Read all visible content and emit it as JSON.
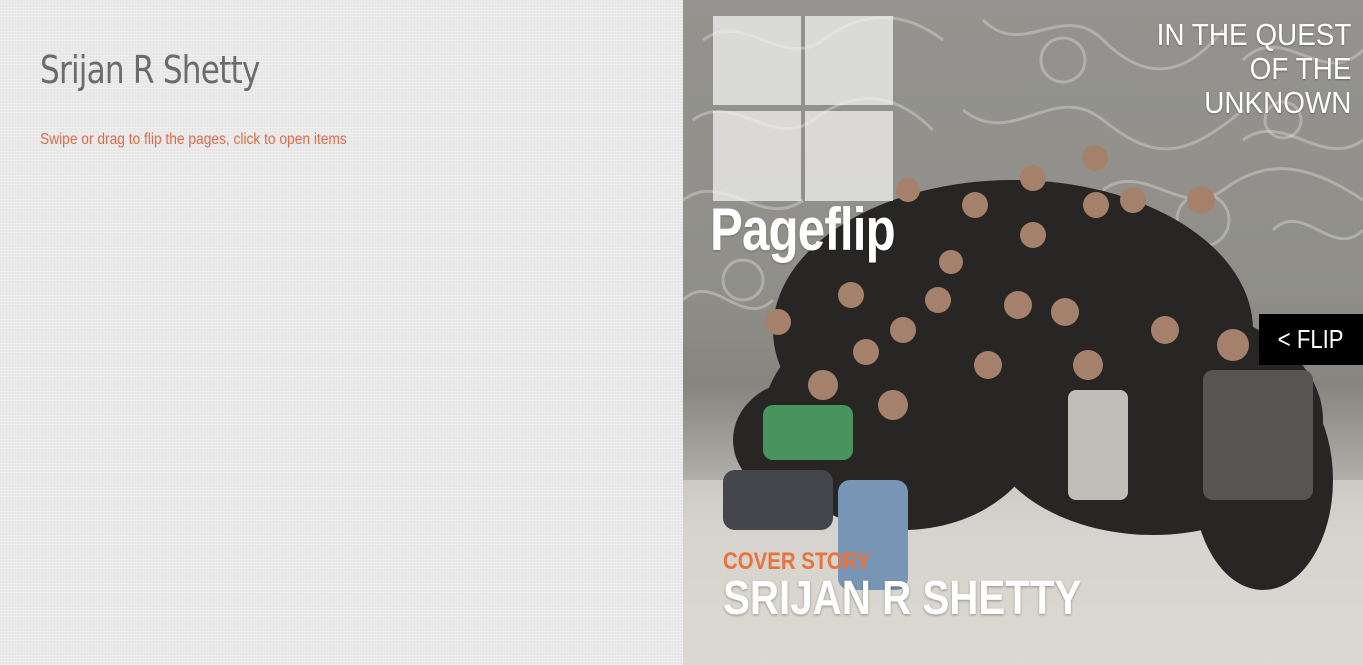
{
  "site": {
    "title": "Srijan R Shetty",
    "instructions": "Swipe or drag to flip the pages, click to open items"
  },
  "cover": {
    "brand": "Pageflip",
    "tagline": [
      "IN THE QUEST",
      "OF THE",
      "UNKNOWN"
    ],
    "kicker": "COVER STORY",
    "headline": "SRIJAN R SHETTY",
    "image": "group-photo"
  },
  "controls": {
    "flip_label": "< FLIP"
  },
  "colors": {
    "accent": "#e06a48",
    "kicker": "#e8733f",
    "left_background": "#e9e9e9",
    "flip_background": "#000000"
  }
}
